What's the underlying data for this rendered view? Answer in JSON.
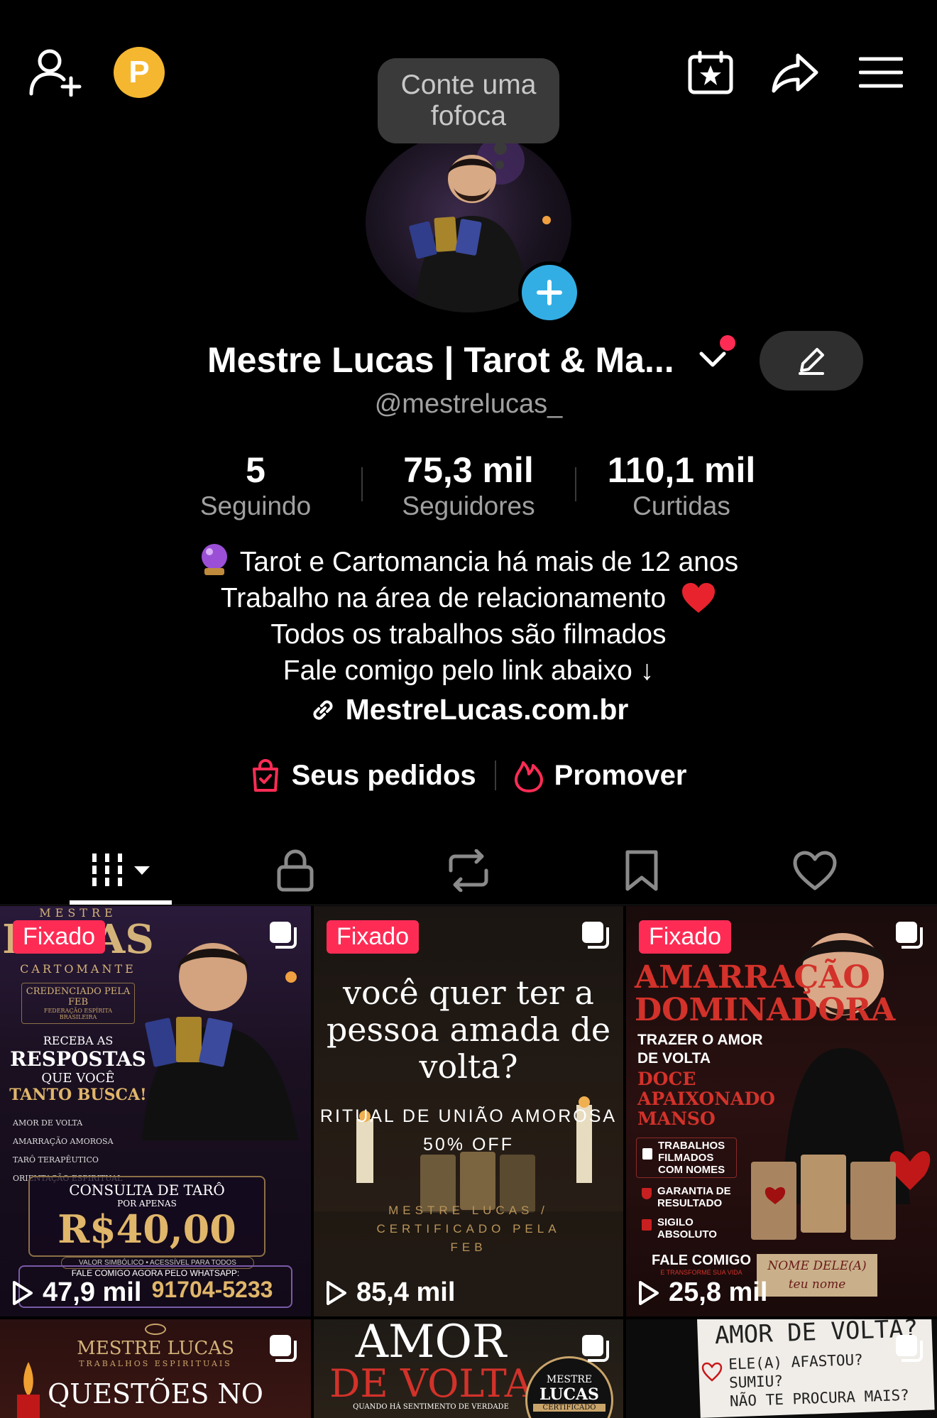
{
  "top_bar": {
    "coin_letter": "P"
  },
  "tooltip": {
    "text": "Conte uma fofoca"
  },
  "profile": {
    "name": "Mestre Lucas | Tarot & Ma...",
    "handle": "@mestrelucas_"
  },
  "stats": [
    {
      "value": "5",
      "label": "Seguindo"
    },
    {
      "value": "75,3 mil",
      "label": "Seguidores"
    },
    {
      "value": "110,1 mil",
      "label": "Curtidas"
    }
  ],
  "bio": {
    "line1": "Tarot e Cartomancia há mais de 12 anos",
    "line2": "Trabalho na área de relacionamento",
    "line3": "Todos os trabalhos são filmados",
    "line4": "Fale comigo pelo link abaixo ↓",
    "link": "MestreLucas.com.br"
  },
  "actions": {
    "orders": "Seus pedidos",
    "promote": "Promover"
  },
  "colors": {
    "accent": "#fe2c55",
    "blue": "#33aee5",
    "coin": "#f5b730"
  },
  "grid": [
    {
      "pinned": "Fixado",
      "views": "47,9 mil",
      "lines": [
        "MESTRE",
        "LUCAS",
        "CARTOMANTE",
        "CREDENCIADO PELA FEB",
        "FEDERAÇÃO ESPÍRITA BRASILEIRA",
        "RECEBA AS",
        "RESPOSTAS",
        "QUE VOCÊ",
        "TANTO BUSCA!",
        "AMOR DE VOLTA",
        "AMARRAÇÃO AMOROSA",
        "TARÔ TERAPÊUTICO",
        "ORIENTAÇÃO ESPIRITUAL",
        "CONSULTA DE TARÔ",
        "POR APENAS",
        "R$40,00",
        "VALOR SIMBÓLICO • ACESSÍVEL PARA TODOS",
        "FALE COMIGO AGORA PELO WHATSAPP:",
        "91704-5233"
      ]
    },
    {
      "pinned": "Fixado",
      "views": "85,4 mil",
      "lines": [
        "você quer ter a",
        "pessoa amada de",
        "volta?",
        "RITUAL DE UNIÃO AMOROSA",
        "50% OFF",
        "MESTRE LUCAS /",
        "CERTIFICADO PELA",
        "FEB"
      ]
    },
    {
      "pinned": "Fixado",
      "views": "25,8 mil",
      "lines": [
        "AMARRAÇÃO",
        "DOMINADORA",
        "TRAZER O AMOR",
        "DE VOLTA",
        "DOCE",
        "APAIXONADO",
        "MANSO",
        "TRABALHOS",
        "FILMADOS",
        "COM NOMES",
        "GARANTIA DE",
        "RESULTADO",
        "SIGILO",
        "ABSOLUTO",
        "FALE COMIGO",
        "E TRANSFORME SUA VIDA",
        "NOME DELE(A)",
        "teu nome"
      ]
    },
    {
      "lines": [
        "MESTRE LUCAS",
        "TRABALHOS ESPIRITUAIS",
        "QUESTÕES NO"
      ]
    },
    {
      "lines": [
        "AMOR",
        "DE VOLTA",
        "QUANDO HÁ SENTIMENTO DE VERDADE",
        "MESTRE",
        "LUCAS",
        "CERTIFICADO"
      ]
    },
    {
      "lines": [
        "AMOR DE VOLTA?",
        "ELE(A) AFASTOU?",
        "SUMIU?",
        "NÃO TE PROCURA MAIS?"
      ]
    }
  ]
}
